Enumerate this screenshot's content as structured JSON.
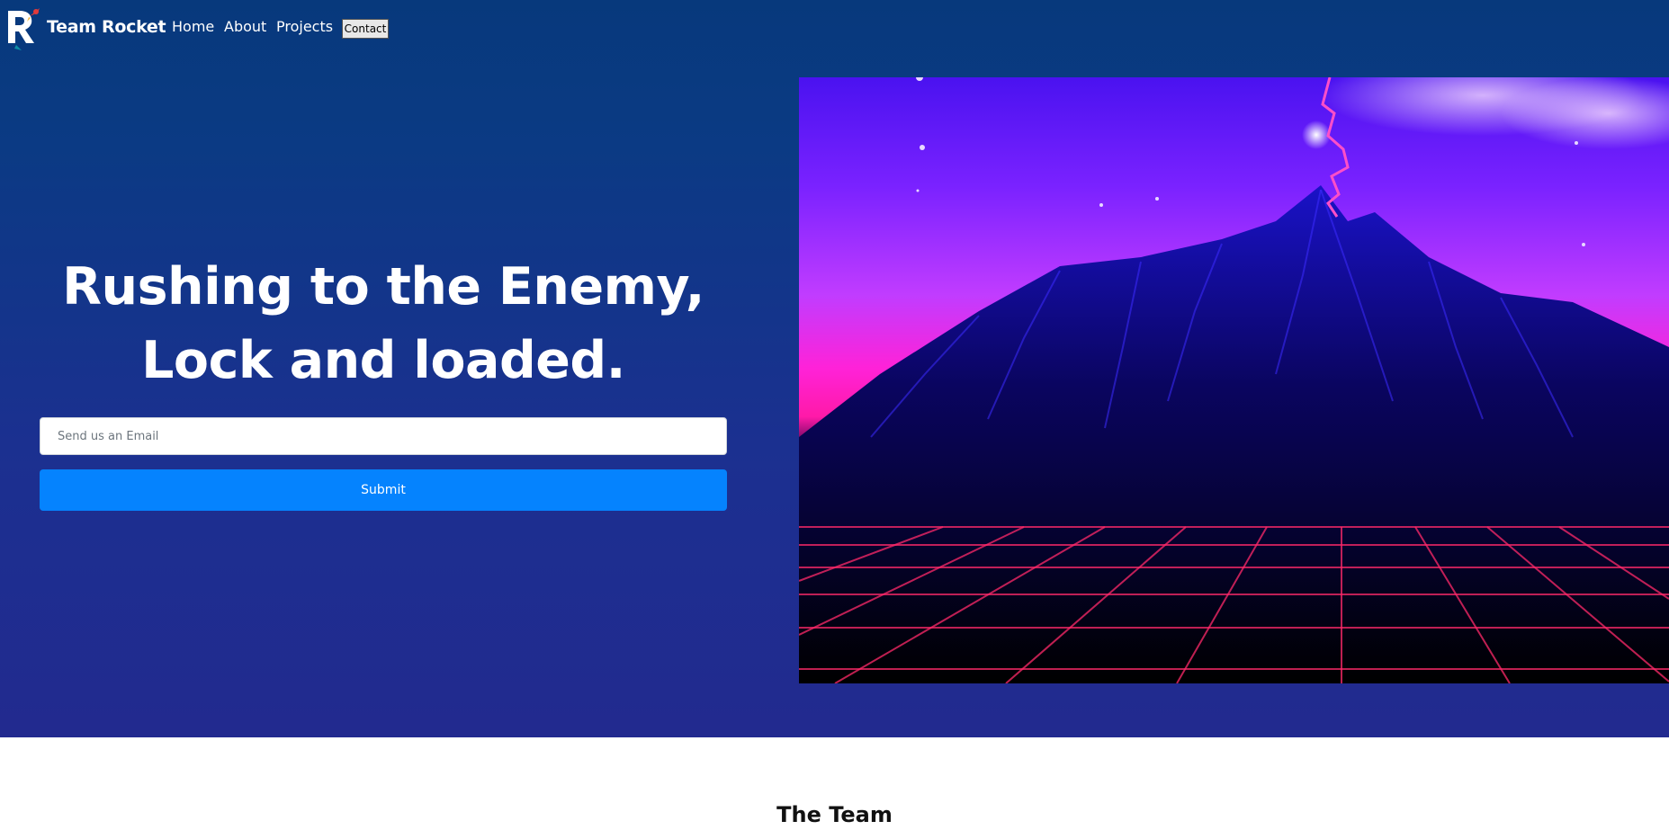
{
  "brand": {
    "name": "Team Rocket",
    "logo_icon": "rocket-r-logo-icon"
  },
  "nav": {
    "items": [
      {
        "label": "Home"
      },
      {
        "label": "About"
      },
      {
        "label": "Projects"
      }
    ],
    "contact_label": "Contact"
  },
  "hero": {
    "headline_line1": "Rushing to the Enemy,",
    "headline_line2": "Lock and loaded.",
    "email_placeholder": "Send us an Email",
    "submit_label": "Submit",
    "image_description_icon": "synthwave-mountain-image"
  },
  "team": {
    "title": "The Team"
  },
  "colors": {
    "hero_top": "#07397c",
    "hero_bottom": "#222a8f",
    "accent_button": "#0583fe",
    "neon_pink": "#ff2fa0",
    "neon_purple": "#7a1cff"
  }
}
